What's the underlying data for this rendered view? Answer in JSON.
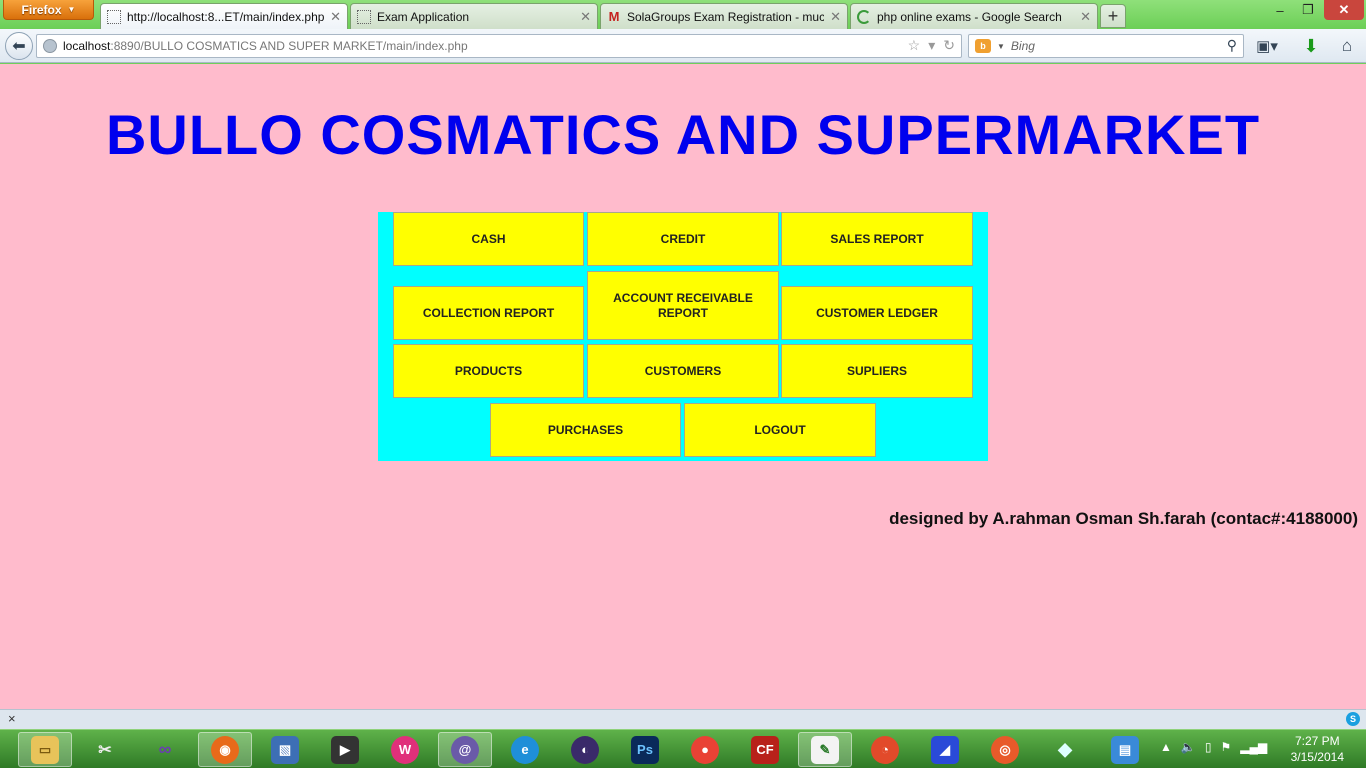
{
  "browser": {
    "menu_label": "Firefox",
    "tabs": [
      {
        "label": "http://localhost:8...ET/main/index.php",
        "icon": "blank-page-icon",
        "active": true
      },
      {
        "label": "Exam Application",
        "icon": "blank-page-icon",
        "active": false
      },
      {
        "label": "SolaGroups Exam Registration - muca...",
        "icon": "gmail-icon",
        "active": false
      },
      {
        "label": "php online exams - Google Search",
        "icon": "loading-icon",
        "active": false
      }
    ],
    "new_tab_label": "+",
    "url_host": "localhost",
    "url_rest": ":8890/BULLO COSMATICS AND SUPER MARKET/main/index.php",
    "search_placeholder": "Bing",
    "window_controls": {
      "minimize": "–",
      "restore": "❐",
      "close": "✕"
    }
  },
  "page": {
    "title": "BULLO COSMATICS AND SUPERMARKET",
    "menu": {
      "cash": "CASH",
      "credit": "CREDIT",
      "sales_report": "SALES REPORT",
      "collection_report": "COLLECTION REPORT",
      "account_receivable_report": "ACCOUNT RECEIVABLE REPORT",
      "customer_ledger": "CUSTOMER LEDGER",
      "products": "PRODUCTS",
      "customers": "CUSTOMERS",
      "supliers": "SUPLIERS",
      "purchases": "PURCHASES",
      "logout": "LOGOUT"
    },
    "credit": "designed by A.rahman Osman Sh.farah (contac#:4188000)"
  },
  "addon_bar": {
    "close": "×",
    "skype": "S"
  },
  "taskbar": {
    "clock_time": "7:27 PM",
    "clock_date": "3/15/2014"
  },
  "colors": {
    "page_bg": "#ffbbcc",
    "title": "#0000ee",
    "panel": "#00ffff",
    "button": "#ffff00"
  }
}
